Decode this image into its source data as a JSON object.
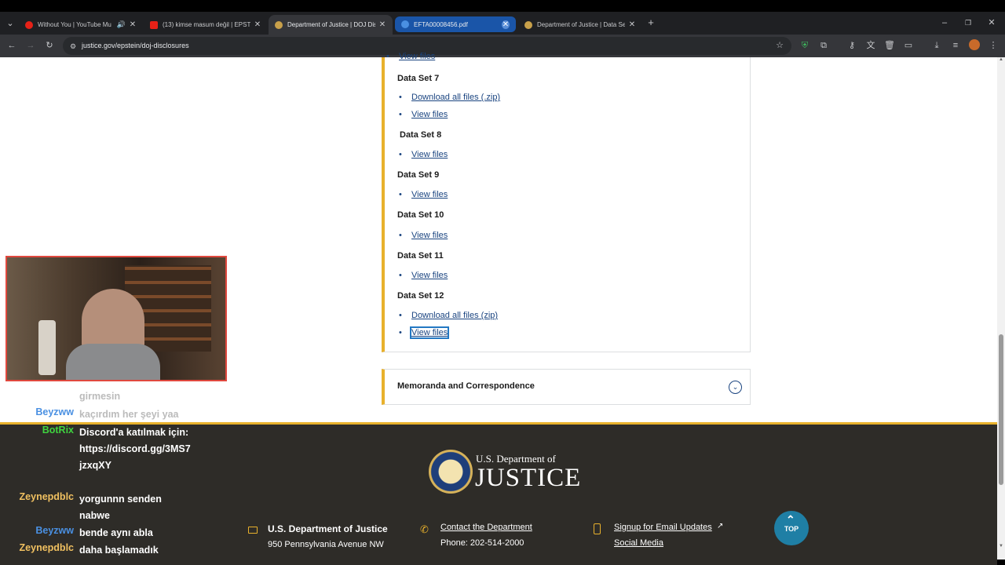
{
  "tabs": [
    {
      "title": "Without You | YouTube Mu",
      "favicon_color": "#e62117"
    },
    {
      "title": "(13) kimse masum değil | EPSTE",
      "favicon_color": "#e62117"
    },
    {
      "title": "Department of Justice | DOJ Dis",
      "favicon_color": "#c8a04a"
    },
    {
      "title": "EFTA00008456.pdf",
      "favicon_color": "#4a90e2"
    },
    {
      "title": "Department of Justice | Data Se",
      "favicon_color": "#c8a04a"
    }
  ],
  "address": {
    "url": "justice.gov/epstein/doj-disclosures"
  },
  "datasets": [
    {
      "top_link": "View files"
    },
    {
      "name": "Data Set 7",
      "links": [
        "Download all files (.zip)",
        "View files"
      ]
    },
    {
      "name": "Data Set 8",
      "links": [
        "View files"
      ]
    },
    {
      "name": "Data Set 9",
      "links": [
        "View files"
      ]
    },
    {
      "name": "Data Set 10",
      "links": [
        "View files"
      ]
    },
    {
      "name": "Data Set 11",
      "links": [
        "View files"
      ]
    },
    {
      "name": "Data Set 12",
      "links": [
        "Download all files (zip)",
        "View files"
      ]
    }
  ],
  "accordion": {
    "title": "Memoranda and Correspondence"
  },
  "chat": [
    {
      "user": "",
      "text": "girmesin"
    },
    {
      "user": "Beyzww",
      "text": "kaçırdım her şeyi yaa",
      "color": "#4a90e2"
    },
    {
      "user": "BotRix",
      "text": "Discord'a katılmak için: https://discord.gg/3MS7jzxqXY",
      "color": "#3fd43f"
    },
    {
      "user": "Zeynepdblc",
      "text": "yorgunnn senden nabwe",
      "color": "#f0c060"
    },
    {
      "user": "Beyzww",
      "text": "bende aynı abla",
      "color": "#4a90e2"
    },
    {
      "user": "Zeynepdblc",
      "text": "daha başlamadık",
      "color": "#f0c060"
    }
  ],
  "footer": {
    "logo_top": "U.S. Department of",
    "logo_main": "JUSTICE",
    "dept_name": "U.S. Department of Justice",
    "address": "950 Pennsylvania Avenue NW",
    "contact_label": "Contact the Department",
    "phone": "Phone: 202-514-2000",
    "email_label": "Signup for Email Updates",
    "social_label": "Social Media",
    "top_label": "TOP"
  }
}
